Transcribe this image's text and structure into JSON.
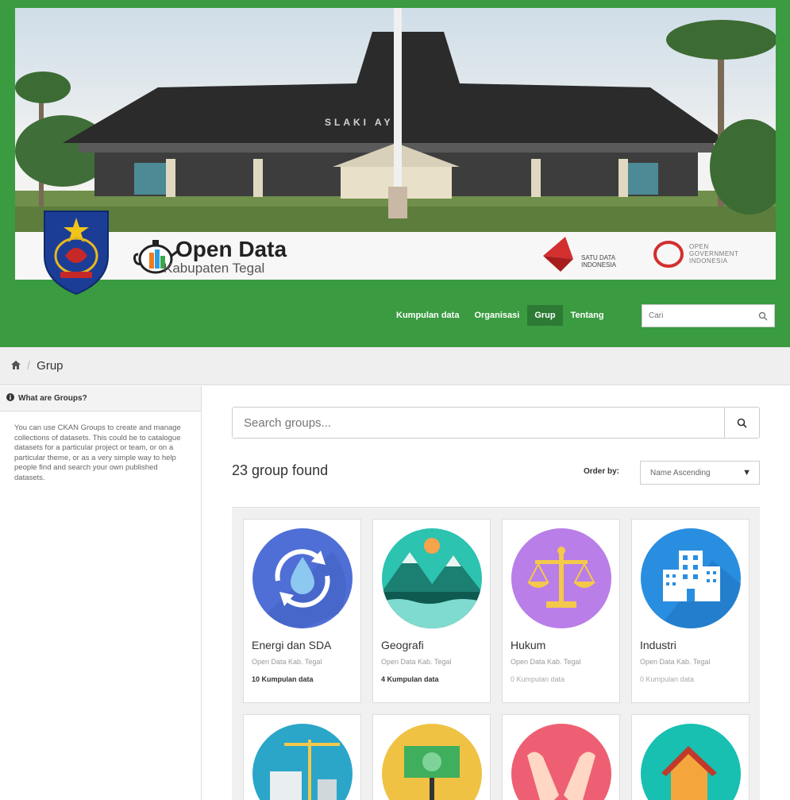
{
  "header": {
    "site_title": "Open Data",
    "site_subtitle": "Kabupaten Tegal",
    "building_sign": "SLAKI AYU",
    "partner1": "SATU DATA INDONESIA",
    "partner2_line1": "OPEN",
    "partner2_line2": "GOVERNMENT",
    "partner2_line3": "INDONESIA"
  },
  "nav": {
    "items": [
      {
        "label": "Kumpulan data",
        "active": false
      },
      {
        "label": "Organisasi",
        "active": false
      },
      {
        "label": "Grup",
        "active": true
      },
      {
        "label": "Tentang",
        "active": false
      }
    ],
    "search_placeholder": "Cari"
  },
  "breadcrumb": {
    "current": "Grup"
  },
  "sidebar": {
    "heading": "What are Groups?",
    "text": "You can use CKAN Groups to create and manage collections of datasets. This could be to catalogue datasets for a particular project or team, or on a particular theme, or as a very simple way to help people find and search your own published datasets."
  },
  "main": {
    "search_placeholder": "Search groups...",
    "found_text": "23 group found",
    "order_label": "Order by:",
    "order_value": "Name Ascending"
  },
  "groups": [
    {
      "title": "Energi dan SDA",
      "org": "Open Data Kab. Tegal",
      "count": "10 Kumpulan data",
      "icon": "water-cycle-icon"
    },
    {
      "title": "Geografi",
      "org": "Open Data Kab. Tegal",
      "count": "4 Kumpulan data",
      "icon": "mountain-icon"
    },
    {
      "title": "Hukum",
      "org": "Open Data Kab. Tegal",
      "count": "0 Kumpulan data",
      "icon": "scales-icon"
    },
    {
      "title": "Industri",
      "org": "Open Data Kab. Tegal",
      "count": "0 Kumpulan data",
      "icon": "buildings-icon"
    },
    {
      "title": "",
      "org": "",
      "count": "",
      "icon": "construction-icon"
    },
    {
      "title": "",
      "org": "",
      "count": "",
      "icon": "money-icon"
    },
    {
      "title": "",
      "org": "",
      "count": "",
      "icon": "hands-icon"
    },
    {
      "title": "",
      "org": "",
      "count": "",
      "icon": "flood-house-icon"
    }
  ],
  "colors": {
    "brand_green": "#3a9b41",
    "active_nav": "#2c7a33",
    "corner_blue": "#1f3e9a"
  }
}
